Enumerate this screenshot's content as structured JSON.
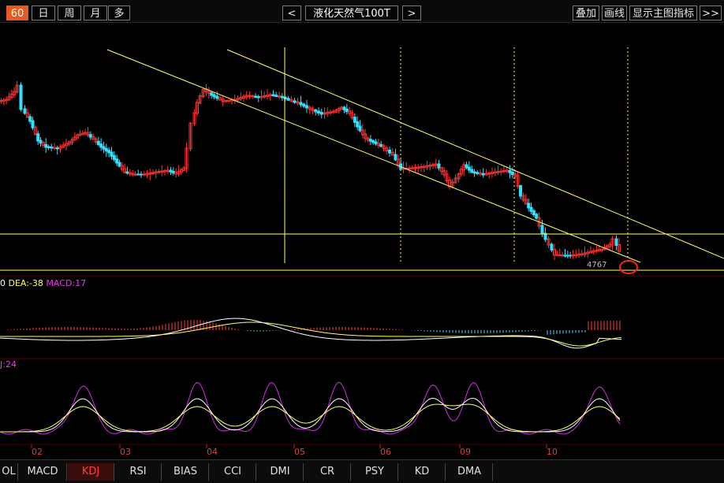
{
  "toolbar": {
    "period_active": "60",
    "periods": [
      "日",
      "周",
      "月",
      "多"
    ],
    "prev_label": "<",
    "next_label": ">",
    "instrument": "液化天然气100T",
    "overlay_label": "叠加",
    "drawline_label": "画线",
    "show_main_indicator_label": "显示主图指标",
    "more_label": ">>"
  },
  "chart": {
    "last_price_label": "4767"
  },
  "indicators": {
    "macd_label_prefix": "0",
    "macd_dea_label": "DEA:-38",
    "macd_value_label": "MACD:17",
    "kdj_label": "J:24"
  },
  "x_axis": {
    "month_labels": [
      "02",
      "03",
      "04",
      "05",
      "06",
      "09",
      "10"
    ]
  },
  "tabs": [
    "OL",
    "MACD",
    "KDJ",
    "RSI",
    "BIAS",
    "CCI",
    "DMI",
    "CR",
    "PSY",
    "KD",
    "DMA"
  ],
  "active_tab": "KDJ",
  "colors": {
    "up_candle": "#ff3030",
    "down_candle": "#30e0ff",
    "trend_line": "#ffff66",
    "accent_tab": "#e45a20",
    "kdj_j": "#d030e0"
  }
}
